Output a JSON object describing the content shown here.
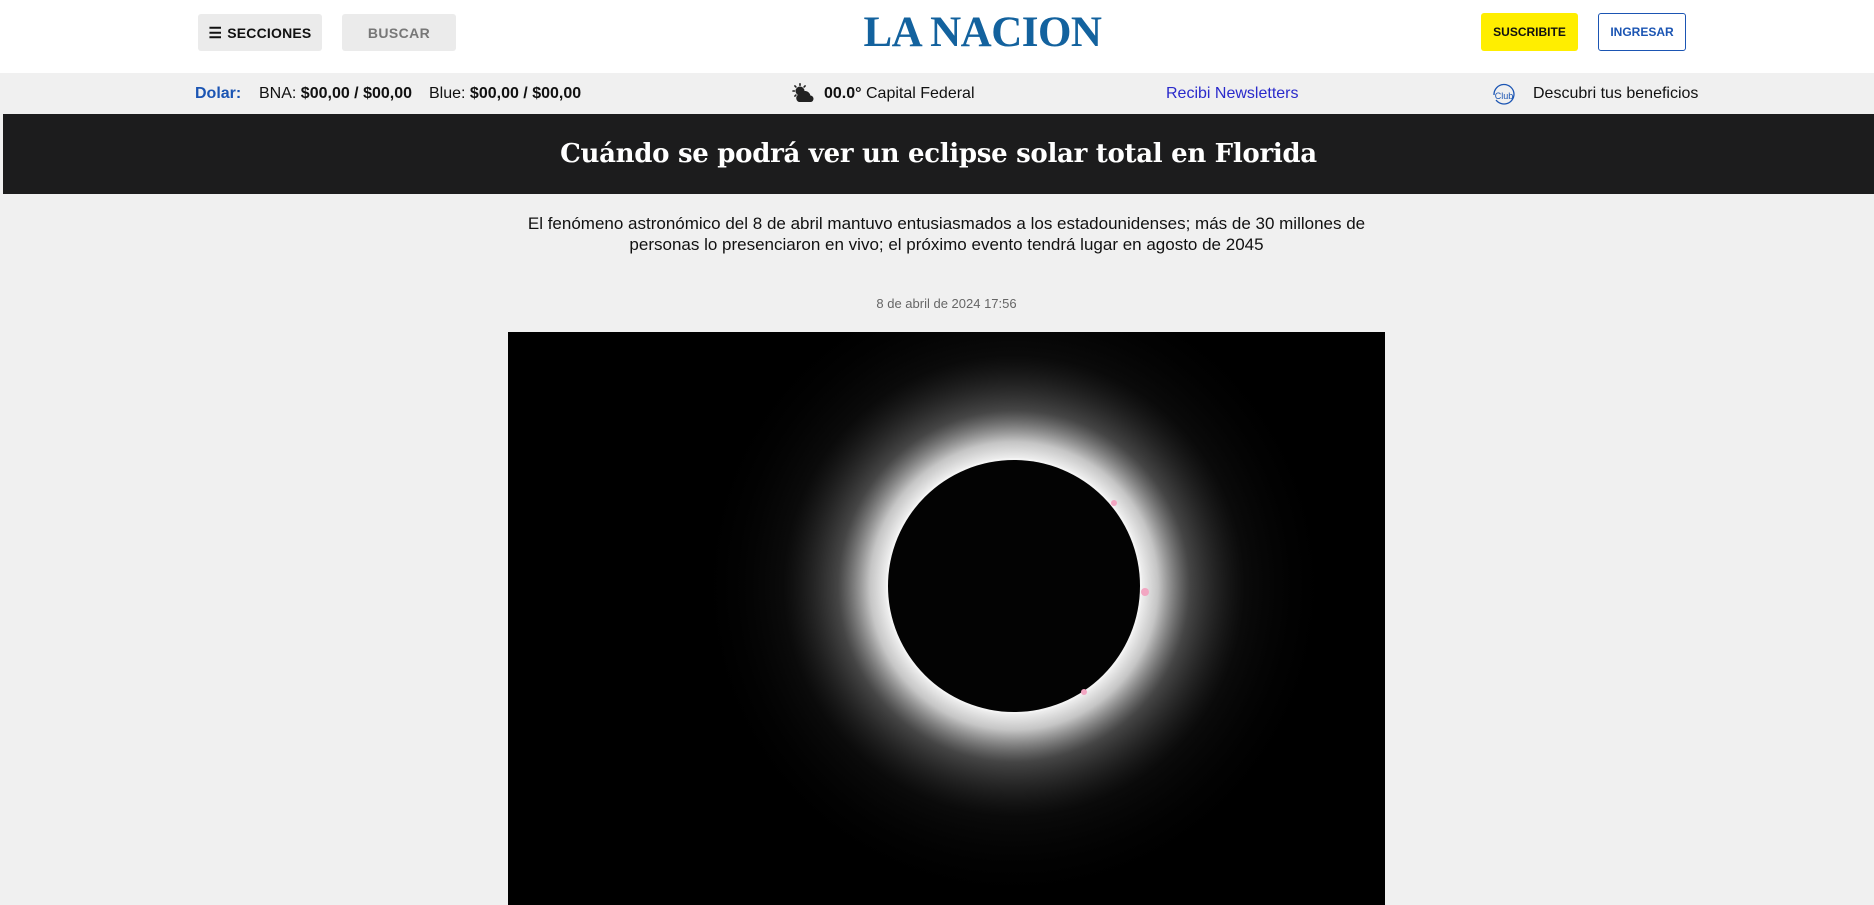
{
  "header": {
    "menu_label": "SECCIONES",
    "search_label": "BUSCAR",
    "logo_text": "LA NACION",
    "subscribe_label": "SUSCRIBITE",
    "login_label": "INGRESAR"
  },
  "infobar": {
    "dolar_label": "Dolar:",
    "bna_label": "BNA:",
    "bna_value": "$00,00 / $00,00",
    "blue_label": "Blue:",
    "blue_value": "$00,00 / $00,00",
    "temperature": "00.0°",
    "city": "Capital Federal",
    "newsletters_label": "Recibi Newsletters",
    "club_icon_text": "Club",
    "benefits_label": "Descubri tus beneficios"
  },
  "article": {
    "title": "Cuándo se podrá ver un eclipse solar total en Florida",
    "subtitle": "El fenómeno astronómico del 8 de abril mantuvo entusiasmados a los estadounidenses; más de 30 millones de personas lo presenciaron en vivo; el próximo evento tendrá lugar en agosto de 2045",
    "date": "8 de abril de 2024 17:56"
  },
  "colors": {
    "brand": "#13629e",
    "accent_link": "#1b55b3",
    "subscribe_bg": "#ffee00",
    "banner_bg": "#1c1c1d",
    "page_bg": "#f0f0f0"
  },
  "icons": {
    "menu": "hamburger-icon",
    "weather": "partly-cloudy-icon",
    "club": "club-icon"
  }
}
